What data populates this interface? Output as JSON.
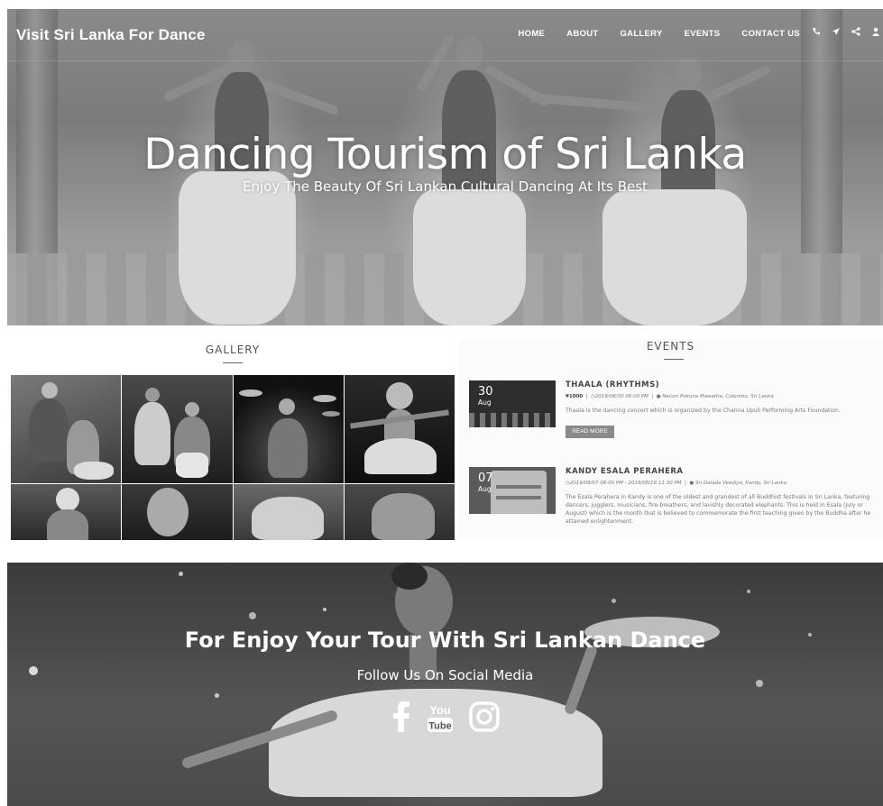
{
  "header": {
    "brand": "Visit Sri Lanka For Dance",
    "menu": [
      "HOME",
      "ABOUT",
      "GALLERY",
      "EVENTS",
      "CONTACT US"
    ],
    "icons": [
      "phone-icon",
      "send-icon",
      "share-icon",
      "user-icon"
    ]
  },
  "hero": {
    "title": "Dancing Tourism of Sri Lanka",
    "subtitle": "Enjoy The Beauty Of Sri Lankan Cultural Dancing At Its Best"
  },
  "gallery": {
    "heading": "GALLERY"
  },
  "events": {
    "heading": "EVENTS",
    "items": [
      {
        "day": "30",
        "month": "Aug",
        "title": "THAALA (RHYTHMS)",
        "price": "¥1000",
        "datetime": "2019/08/30 06:00 PM",
        "location": "Nelum Pokuna Mawatha, Colombo, Sri Lanka",
        "description": "Thaala is the dancing concert which is organized by the Channa Upuli Performing Arts Foundation.",
        "button": "READ MORE"
      },
      {
        "day": "07",
        "month": "Aug",
        "title": "KANDY ESALA PERAHERA",
        "datetime": "2019/08/07 06:00 PM - 2019/08/16 11:30 PM",
        "location": "Sri Dalada Veediya, Kandy, Sri Lanka",
        "description": "The Esala Perahera in Kandy is one of the oldest and grandest of all Buddhist festivals in Sri Lanka, featuring dancers, jugglers, musicians, fire-breathers, and lavishly decorated elephants. This is held in Esala (July or August) which is the month that is believed to commemorate the first teaching given by the Buddha after he attained enlightenment."
      }
    ]
  },
  "social": {
    "title": "For Enjoy Your Tour With Sri Lankan Dance",
    "subtitle": "Follow Us On Social Media",
    "icons": [
      "facebook-icon",
      "youtube-icon",
      "instagram-icon"
    ],
    "youtube_top": "You",
    "youtube_bottom": "Tube"
  }
}
